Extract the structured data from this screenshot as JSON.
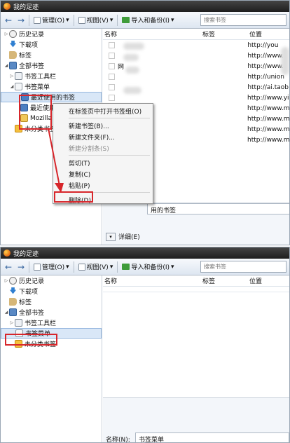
{
  "window": {
    "title": "我的足迹"
  },
  "toolbar": {
    "back": "←",
    "forward": "→",
    "manage": "管理(O)",
    "view": "视图(V)",
    "import_backup": "导入和备份(I)",
    "dropdown_arrow": "▾",
    "search_placeholder": "搜索书签"
  },
  "tree": {
    "history": "历史记录",
    "downloads": "下载项",
    "tags": "标签",
    "all_bookmarks": "全部书签",
    "toolbar_folder": "书签工具栏",
    "menu_folder": "书签菜单",
    "recent_bookmarks": "最近使用的书签",
    "recent_tags": "最近使用",
    "mozilla": "Mozilla",
    "unsorted": "未分类书签"
  },
  "columns": {
    "name": "名称",
    "tags": "标签",
    "location": "位置"
  },
  "bookmarks_top": [
    {
      "name": "",
      "location": "http://you"
    },
    {
      "name": "",
      "location": "http://www."
    },
    {
      "name": "网",
      "location": "http://www."
    },
    {
      "name": "",
      "location": "http://union"
    },
    {
      "name": "",
      "location": "http://ai.taob"
    },
    {
      "name": "",
      "location": "http://www.yih"
    },
    {
      "name": "x",
      "location": "http://www.mo"
    },
    {
      "name": "",
      "location": "http://www.mo"
    },
    {
      "name": "",
      "location": "http://www.mo"
    },
    {
      "name": "",
      "location": "http://www.mo"
    }
  ],
  "context_menu": [
    {
      "label": "在标签页中打开书签组(O)",
      "disabled": false
    },
    {
      "sep": true
    },
    {
      "label": "新建书签(B)...",
      "disabled": false
    },
    {
      "label": "新建文件夹(F)...",
      "disabled": false
    },
    {
      "label": "新建分割条(S)",
      "disabled": true
    },
    {
      "sep": true
    },
    {
      "label": "剪切(T)",
      "disabled": false
    },
    {
      "label": "复制(C)",
      "disabled": false
    },
    {
      "label": "粘贴(P)",
      "disabled": false
    },
    {
      "sep": true
    },
    {
      "label": "删除(D)",
      "disabled": false
    }
  ],
  "details_top": {
    "name_value": "用的书签",
    "toggle_label": "详细(E)"
  },
  "details_bottom": {
    "name_label": "名称(N):",
    "name_value": "书签菜单"
  },
  "colors": {
    "selection": "#d9e7f7",
    "annotation_red": "#d7262b",
    "toolbar_bg": "#dde6f1"
  }
}
